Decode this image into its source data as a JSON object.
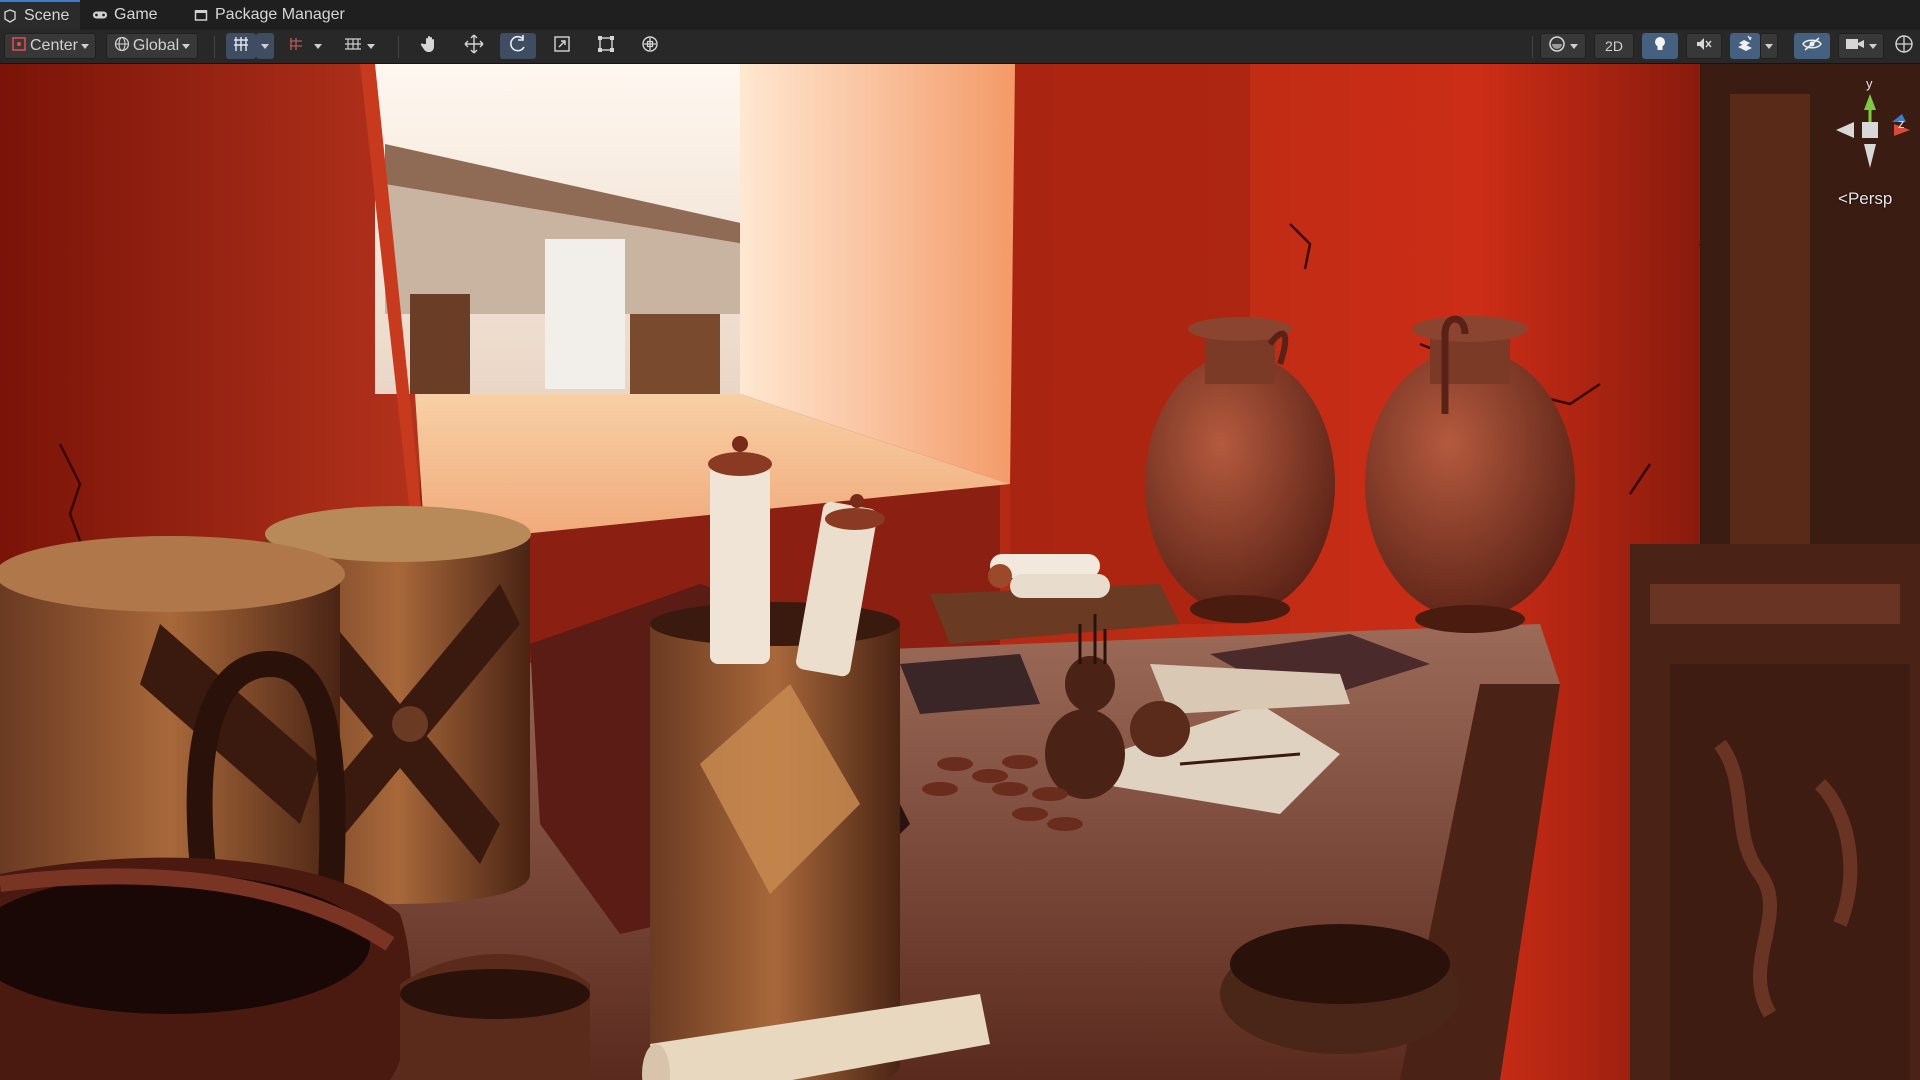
{
  "tabs": [
    {
      "label": "Scene",
      "icon": "scene-icon",
      "active": true
    },
    {
      "label": "Game",
      "icon": "gamepad-icon",
      "active": false
    },
    {
      "label": "Package Manager",
      "icon": "package-icon",
      "active": false
    }
  ],
  "toolbar": {
    "pivot_mode": "Center",
    "pivot_rotation": "Global",
    "mode_2d": "2D",
    "accent_color": "#3f4d63",
    "tools": [
      "hand-tool-icon",
      "move-tool-icon",
      "rotate-tool-icon",
      "scale-tool-icon",
      "rect-tool-icon",
      "transform-tool-icon"
    ],
    "active_tool": "rotate-tool-icon"
  },
  "scene_gizmo": {
    "axis_y": "y",
    "axis_z": "z",
    "projection": "Persp"
  }
}
